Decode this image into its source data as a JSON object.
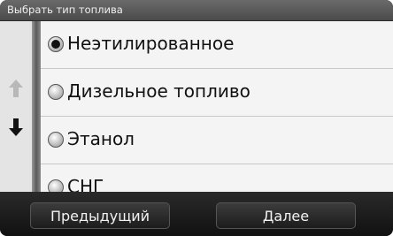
{
  "header": {
    "title": "Выбрать тип топлива"
  },
  "options": [
    {
      "label": "Неэтилированное",
      "selected": true
    },
    {
      "label": "Дизельное топливо",
      "selected": false
    },
    {
      "label": "Этанол",
      "selected": false
    },
    {
      "label": "СНГ",
      "selected": false
    }
  ],
  "scroll": {
    "up_icon": "arrow-up-icon",
    "down_icon": "arrow-down-icon"
  },
  "footer": {
    "prev_label": "Предыдущий",
    "next_label": "Далее"
  },
  "colors": {
    "up_arrow_disabled": "#b8b8b8",
    "down_arrow": "#111111"
  }
}
